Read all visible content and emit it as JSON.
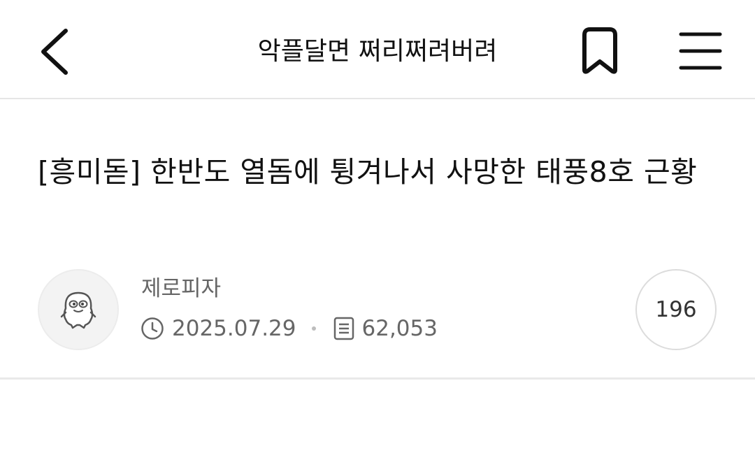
{
  "header": {
    "title": "악플달면 쩌리쩌려버려",
    "back_icon": "chevron-left-icon",
    "bookmark_icon": "bookmark-icon",
    "menu_icon": "hamburger-menu-icon"
  },
  "post": {
    "title": "[흥미돋] 한반도 열돔에 튕겨나서 사망한 태풍8호 근황",
    "author": "제로피자",
    "date": "2025.07.29",
    "views": "62,053",
    "comments": "196",
    "date_icon": "clock-icon",
    "views_icon": "document-icon",
    "avatar_icon": "cartoon-avatar-icon"
  }
}
